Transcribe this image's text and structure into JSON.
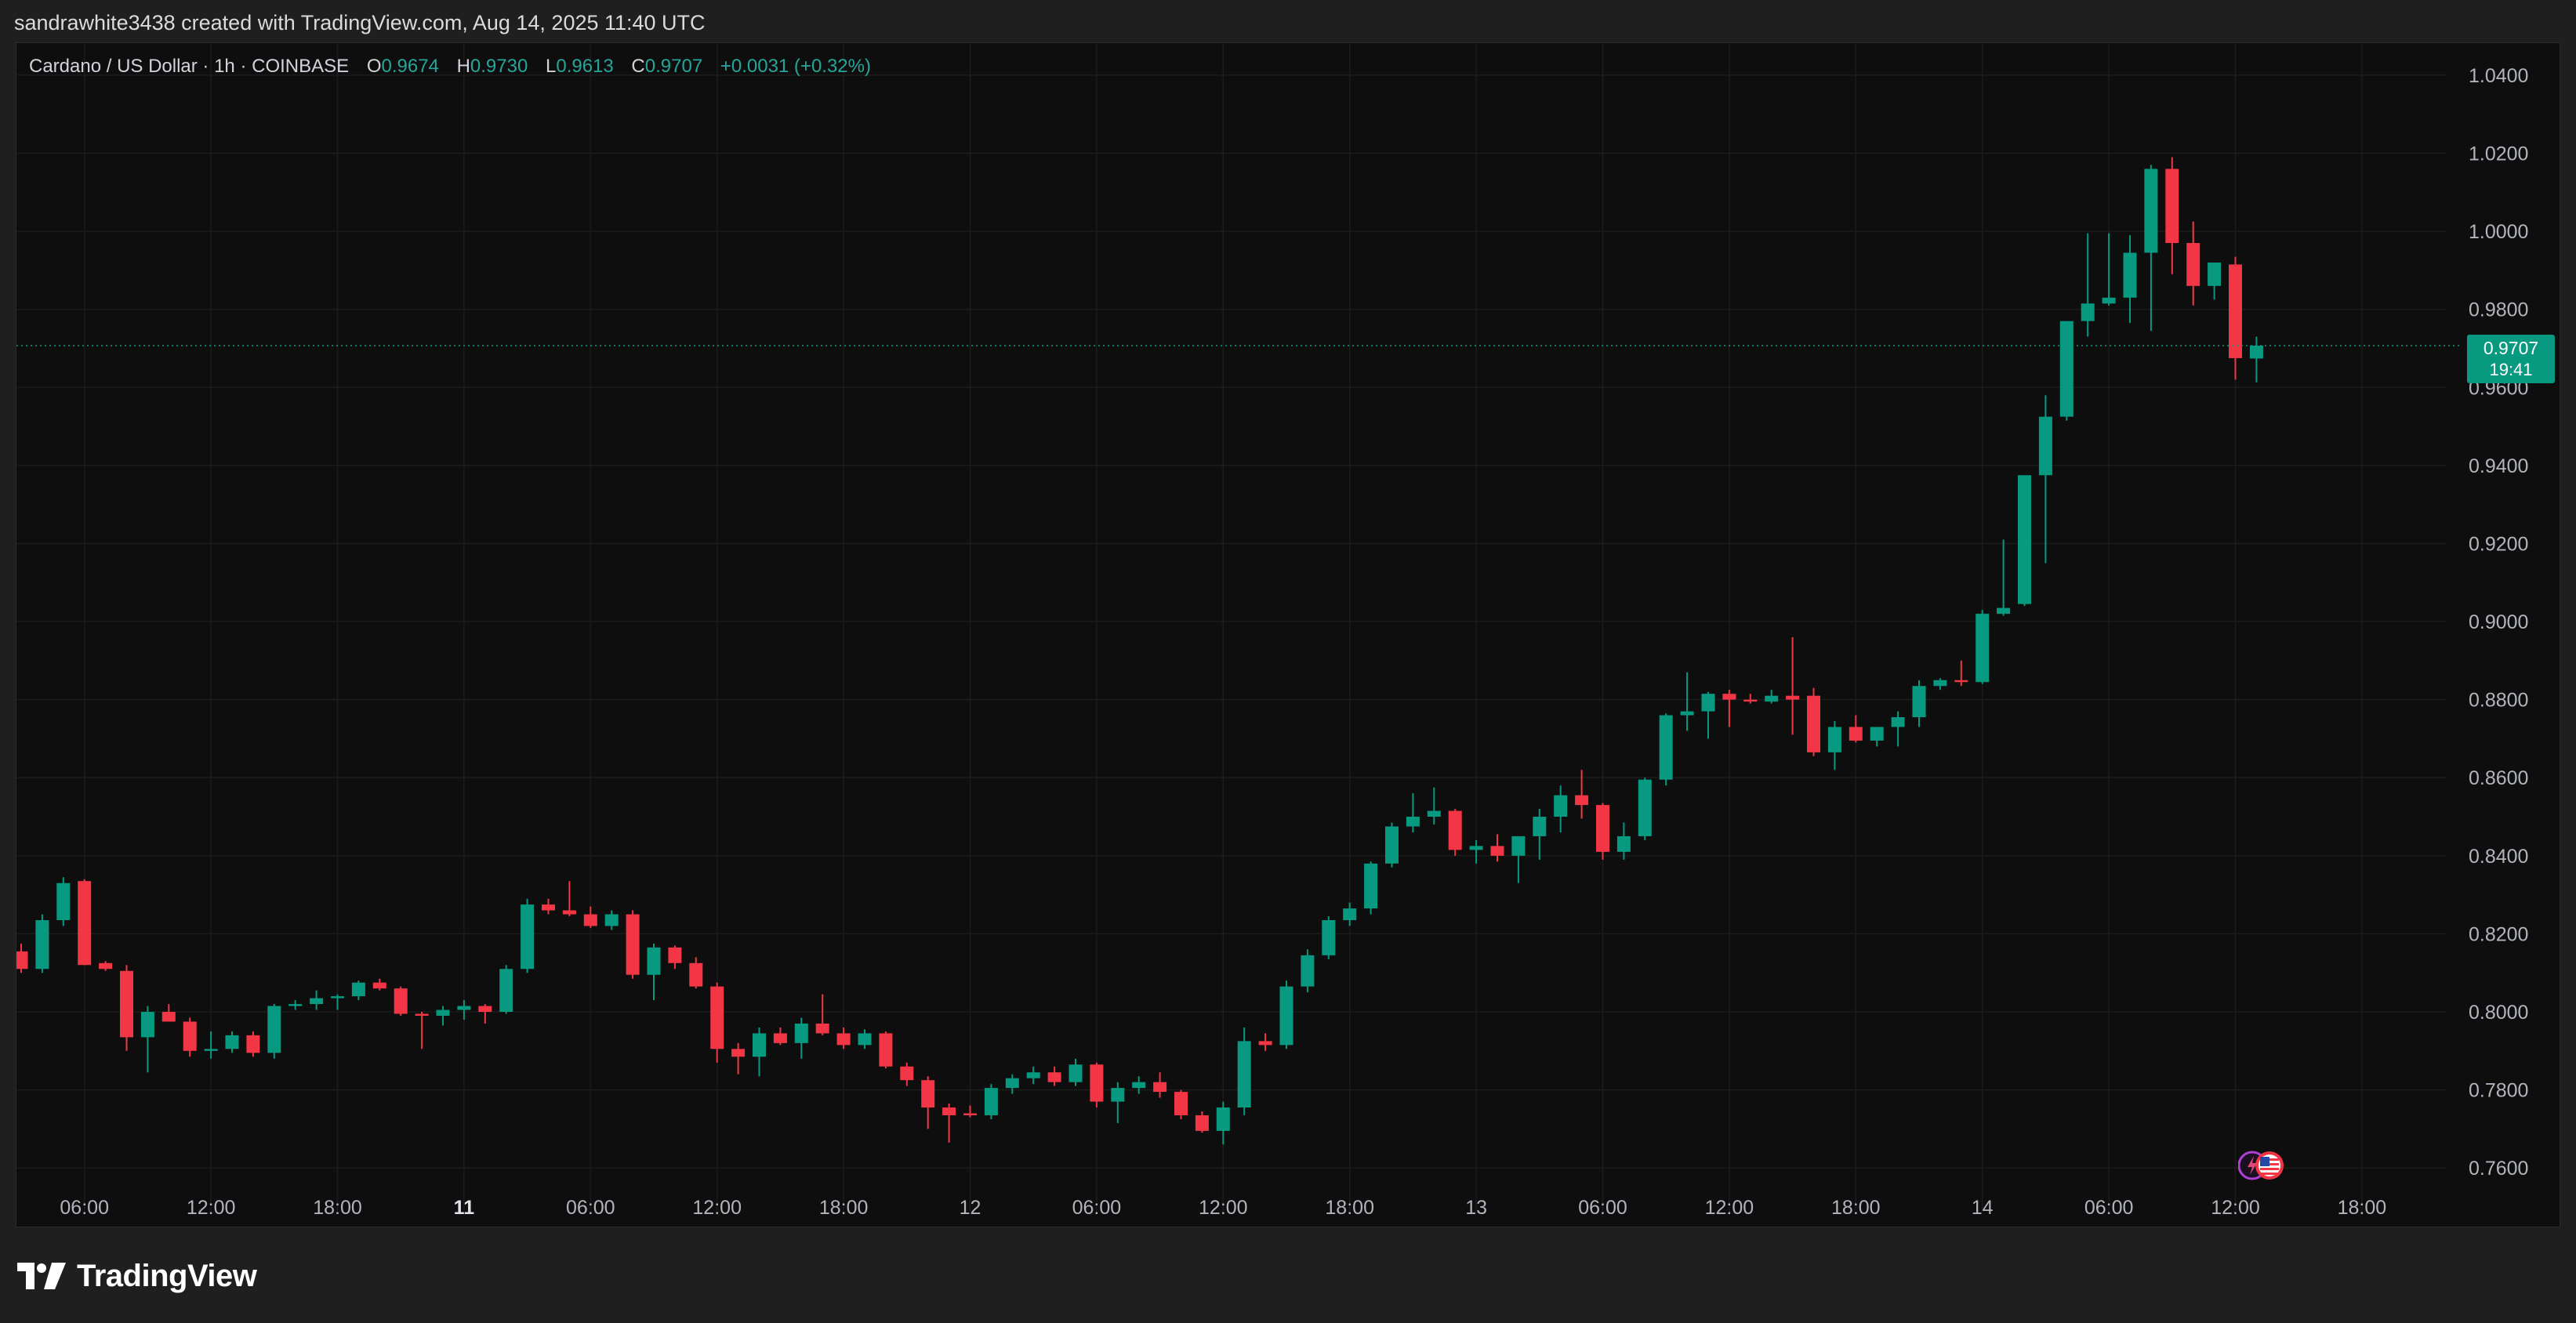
{
  "header": {
    "creator_line": "sandrawhite3438 created with TradingView.com, Aug 14, 2025 11:40 UTC"
  },
  "legend": {
    "symbol": "Cardano / US Dollar · 1h · COINBASE",
    "o_label": "O",
    "o_value": "0.9674",
    "h_label": "H",
    "h_value": "0.9730",
    "l_label": "L",
    "l_value": "0.9613",
    "c_label": "C",
    "c_value": "0.9707",
    "change": "+0.0031 (+0.32%)"
  },
  "price_badge": {
    "price": "0.9707",
    "countdown": "19:41"
  },
  "brand": {
    "name": "TradingView"
  },
  "colors": {
    "up": "#089981",
    "down": "#f23645",
    "background": "#0e0e0e",
    "grid": "#1c1c1c",
    "axis_text": "#b2b5be"
  },
  "icons": [
    "tradingview-logo-icon",
    "lightning-event-icon",
    "us-flag-event-icon"
  ],
  "chart_data": {
    "type": "candlestick",
    "title": "",
    "xlabel": "",
    "ylabel": "",
    "ylim": [
      0.75,
      1.044
    ],
    "y_ticks": [
      "1.0400",
      "1.0200",
      "1.0000",
      "0.9800",
      "0.9600",
      "0.9400",
      "0.9200",
      "0.9000",
      "0.8800",
      "0.8600",
      "0.8400",
      "0.8200",
      "0.8000",
      "0.7800",
      "0.7600"
    ],
    "x_ticks": [
      {
        "label": "06:00",
        "index": 3,
        "bold": false
      },
      {
        "label": "12:00",
        "index": 9,
        "bold": false
      },
      {
        "label": "18:00",
        "index": 15,
        "bold": false
      },
      {
        "label": "11",
        "index": 21,
        "bold": true
      },
      {
        "label": "06:00",
        "index": 27,
        "bold": false
      },
      {
        "label": "12:00",
        "index": 33,
        "bold": false
      },
      {
        "label": "18:00",
        "index": 39,
        "bold": false
      },
      {
        "label": "12",
        "index": 45,
        "bold": false
      },
      {
        "label": "06:00",
        "index": 51,
        "bold": false
      },
      {
        "label": "12:00",
        "index": 57,
        "bold": false
      },
      {
        "label": "18:00",
        "index": 63,
        "bold": false
      },
      {
        "label": "13",
        "index": 69,
        "bold": false
      },
      {
        "label": "06:00",
        "index": 75,
        "bold": false
      },
      {
        "label": "12:00",
        "index": 81,
        "bold": false
      },
      {
        "label": "18:00",
        "index": 87,
        "bold": false
      },
      {
        "label": "14",
        "index": 93,
        "bold": false
      },
      {
        "label": "06:00",
        "index": 99,
        "bold": false
      },
      {
        "label": "12:00",
        "index": 105,
        "bold": false
      },
      {
        "label": "18:00",
        "index": 111,
        "bold": false
      }
    ],
    "last_price": 0.9707,
    "grid": true,
    "candles": [
      [
        0.8155,
        0.8175,
        0.81,
        0.811
      ],
      [
        0.811,
        0.825,
        0.81,
        0.8235
      ],
      [
        0.8235,
        0.8345,
        0.822,
        0.833
      ],
      [
        0.8335,
        0.834,
        0.812,
        0.812
      ],
      [
        0.8125,
        0.813,
        0.8105,
        0.811
      ],
      [
        0.8105,
        0.812,
        0.79,
        0.7935
      ],
      [
        0.7935,
        0.8015,
        0.7845,
        0.8
      ],
      [
        0.8,
        0.802,
        0.7975,
        0.7975
      ],
      [
        0.7975,
        0.7985,
        0.7885,
        0.79
      ],
      [
        0.79,
        0.795,
        0.788,
        0.7905
      ],
      [
        0.7905,
        0.795,
        0.7895,
        0.794
      ],
      [
        0.794,
        0.795,
        0.7885,
        0.7895
      ],
      [
        0.7895,
        0.802,
        0.788,
        0.8015
      ],
      [
        0.8015,
        0.803,
        0.8005,
        0.802
      ],
      [
        0.802,
        0.8055,
        0.8005,
        0.8035
      ],
      [
        0.8035,
        0.8045,
        0.8005,
        0.804
      ],
      [
        0.804,
        0.808,
        0.803,
        0.8075
      ],
      [
        0.8075,
        0.8085,
        0.8055,
        0.806
      ],
      [
        0.806,
        0.8065,
        0.799,
        0.7995
      ],
      [
        0.7995,
        0.8,
        0.7905,
        0.799
      ],
      [
        0.799,
        0.8015,
        0.7965,
        0.8005
      ],
      [
        0.8005,
        0.803,
        0.798,
        0.8015
      ],
      [
        0.8015,
        0.802,
        0.797,
        0.8
      ],
      [
        0.8,
        0.812,
        0.7995,
        0.811
      ],
      [
        0.811,
        0.829,
        0.81,
        0.8275
      ],
      [
        0.8275,
        0.829,
        0.825,
        0.826
      ],
      [
        0.826,
        0.8335,
        0.8245,
        0.825
      ],
      [
        0.825,
        0.827,
        0.8215,
        0.822
      ],
      [
        0.822,
        0.826,
        0.821,
        0.825
      ],
      [
        0.825,
        0.826,
        0.8085,
        0.8095
      ],
      [
        0.8095,
        0.8175,
        0.803,
        0.8165
      ],
      [
        0.8165,
        0.817,
        0.811,
        0.8125
      ],
      [
        0.8125,
        0.814,
        0.806,
        0.8065
      ],
      [
        0.8065,
        0.8075,
        0.787,
        0.7905
      ],
      [
        0.7905,
        0.792,
        0.784,
        0.7885
      ],
      [
        0.7885,
        0.796,
        0.7835,
        0.7945
      ],
      [
        0.7945,
        0.796,
        0.7915,
        0.792
      ],
      [
        0.792,
        0.7985,
        0.788,
        0.797
      ],
      [
        0.797,
        0.8045,
        0.794,
        0.7945
      ],
      [
        0.7945,
        0.796,
        0.7905,
        0.7915
      ],
      [
        0.7915,
        0.7955,
        0.7905,
        0.7945
      ],
      [
        0.7945,
        0.795,
        0.7855,
        0.786
      ],
      [
        0.786,
        0.787,
        0.781,
        0.7825
      ],
      [
        0.7825,
        0.7835,
        0.77,
        0.7755
      ],
      [
        0.7755,
        0.7765,
        0.7665,
        0.7735
      ],
      [
        0.774,
        0.776,
        0.773,
        0.7735
      ],
      [
        0.7735,
        0.7815,
        0.7725,
        0.7805
      ],
      [
        0.7805,
        0.784,
        0.779,
        0.783
      ],
      [
        0.783,
        0.786,
        0.7815,
        0.7845
      ],
      [
        0.7845,
        0.786,
        0.781,
        0.782
      ],
      [
        0.782,
        0.788,
        0.781,
        0.7865
      ],
      [
        0.7865,
        0.787,
        0.7755,
        0.777
      ],
      [
        0.777,
        0.782,
        0.7715,
        0.7805
      ],
      [
        0.7805,
        0.7835,
        0.779,
        0.782
      ],
      [
        0.782,
        0.7845,
        0.778,
        0.7795
      ],
      [
        0.7795,
        0.78,
        0.7725,
        0.7735
      ],
      [
        0.7735,
        0.7745,
        0.769,
        0.7695
      ],
      [
        0.7695,
        0.777,
        0.766,
        0.7755
      ],
      [
        0.7755,
        0.796,
        0.7735,
        0.7925
      ],
      [
        0.7925,
        0.7945,
        0.79,
        0.7915
      ],
      [
        0.7915,
        0.808,
        0.7905,
        0.8065
      ],
      [
        0.8065,
        0.816,
        0.805,
        0.8145
      ],
      [
        0.8145,
        0.8245,
        0.8135,
        0.8235
      ],
      [
        0.8235,
        0.828,
        0.822,
        0.8265
      ],
      [
        0.8265,
        0.8385,
        0.825,
        0.838
      ],
      [
        0.838,
        0.8485,
        0.837,
        0.8475
      ],
      [
        0.8475,
        0.856,
        0.846,
        0.85
      ],
      [
        0.85,
        0.8575,
        0.848,
        0.8515
      ],
      [
        0.8515,
        0.852,
        0.84,
        0.8415
      ],
      [
        0.8415,
        0.844,
        0.838,
        0.8425
      ],
      [
        0.8425,
        0.8455,
        0.8385,
        0.84
      ],
      [
        0.84,
        0.845,
        0.833,
        0.845
      ],
      [
        0.845,
        0.852,
        0.839,
        0.85
      ],
      [
        0.85,
        0.858,
        0.846,
        0.8555
      ],
      [
        0.8555,
        0.862,
        0.8495,
        0.853
      ],
      [
        0.853,
        0.8535,
        0.839,
        0.841
      ],
      [
        0.841,
        0.8485,
        0.839,
        0.845
      ],
      [
        0.845,
        0.86,
        0.844,
        0.8595
      ],
      [
        0.8595,
        0.8765,
        0.858,
        0.876
      ],
      [
        0.876,
        0.887,
        0.872,
        0.877
      ],
      [
        0.877,
        0.882,
        0.87,
        0.8815
      ],
      [
        0.8815,
        0.8825,
        0.873,
        0.88
      ],
      [
        0.88,
        0.8815,
        0.879,
        0.8795
      ],
      [
        0.8795,
        0.8825,
        0.879,
        0.881
      ],
      [
        0.881,
        0.896,
        0.871,
        0.88
      ],
      [
        0.881,
        0.883,
        0.8655,
        0.8665
      ],
      [
        0.8665,
        0.8745,
        0.862,
        0.873
      ],
      [
        0.873,
        0.876,
        0.869,
        0.8695
      ],
      [
        0.8695,
        0.873,
        0.868,
        0.873
      ],
      [
        0.873,
        0.877,
        0.868,
        0.8755
      ],
      [
        0.8755,
        0.885,
        0.873,
        0.8835
      ],
      [
        0.8835,
        0.8855,
        0.8825,
        0.885
      ],
      [
        0.885,
        0.89,
        0.8835,
        0.8845
      ],
      [
        0.8845,
        0.903,
        0.884,
        0.902
      ],
      [
        0.902,
        0.921,
        0.9015,
        0.9035
      ],
      [
        0.9045,
        0.9375,
        0.904,
        0.9375
      ],
      [
        0.9375,
        0.958,
        0.915,
        0.9525
      ],
      [
        0.9525,
        0.977,
        0.9515,
        0.977
      ],
      [
        0.977,
        0.9995,
        0.973,
        0.9815
      ],
      [
        0.9815,
        0.9995,
        0.981,
        0.983
      ],
      [
        0.983,
        0.999,
        0.9765,
        0.9945
      ],
      [
        0.9945,
        1.017,
        0.9745,
        1.016
      ],
      [
        1.016,
        1.019,
        0.989,
        0.997
      ],
      [
        0.997,
        1.0025,
        0.981,
        0.986
      ],
      [
        0.986,
        0.9915,
        0.9825,
        0.992
      ],
      [
        0.9915,
        0.9935,
        0.962,
        0.9675
      ],
      [
        0.9674,
        0.973,
        0.9613,
        0.9707
      ]
    ]
  }
}
